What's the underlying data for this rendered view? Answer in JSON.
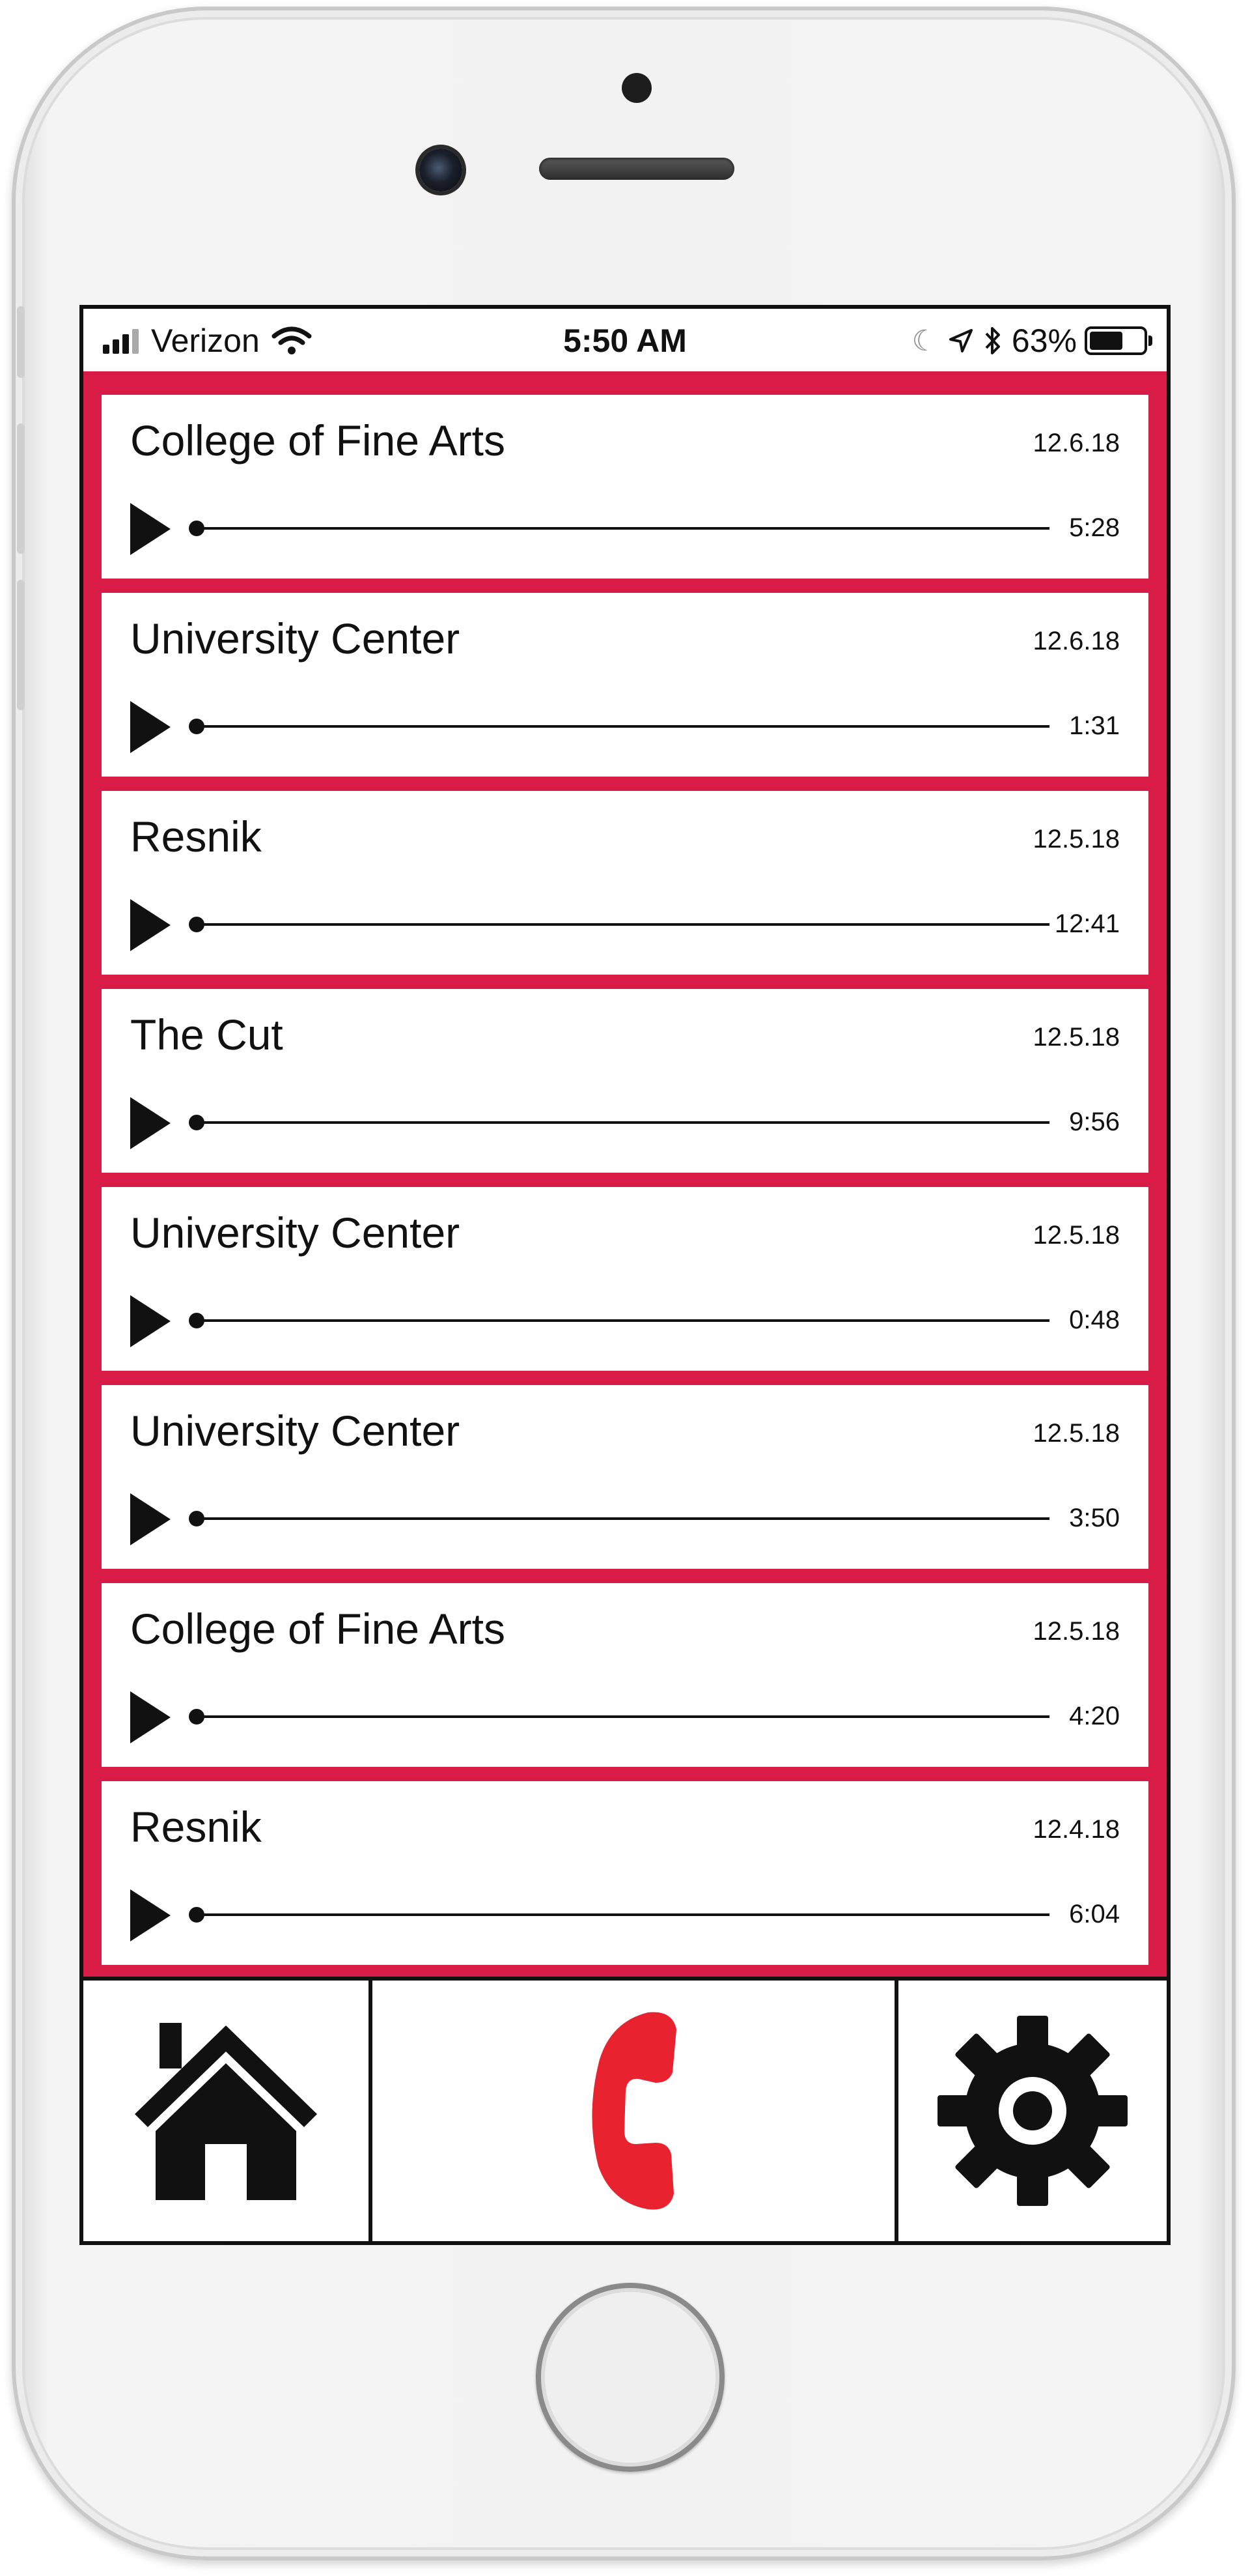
{
  "status_bar": {
    "carrier": "Verizon",
    "time": "5:50 AM",
    "battery_percent": "63%",
    "battery_level": 0.63,
    "icons": [
      "cellular-signal-icon",
      "wifi-icon",
      "moon-icon",
      "location-arrow-icon",
      "bluetooth-icon",
      "battery-icon"
    ]
  },
  "recordings": [
    {
      "title": "College of Fine Arts",
      "date": "12.6.18",
      "duration": "5:28"
    },
    {
      "title": "University Center",
      "date": "12.6.18",
      "duration": "1:31"
    },
    {
      "title": "Resnik",
      "date": "12.5.18",
      "duration": "12:41"
    },
    {
      "title": "The Cut",
      "date": "12.5.18",
      "duration": "9:56"
    },
    {
      "title": "University Center",
      "date": "12.5.18",
      "duration": "0:48"
    },
    {
      "title": "University Center",
      "date": "12.5.18",
      "duration": "3:50"
    },
    {
      "title": "College of Fine Arts",
      "date": "12.5.18",
      "duration": "4:20"
    },
    {
      "title": "Resnik",
      "date": "12.4.18",
      "duration": "6:04"
    }
  ],
  "bottom_nav": {
    "items": [
      "home-icon",
      "phone-icon",
      "gear-icon"
    ]
  },
  "colors": {
    "accent": "#d91c46",
    "call_icon": "#e8232f",
    "text": "#111111",
    "background": "#ffffff"
  }
}
